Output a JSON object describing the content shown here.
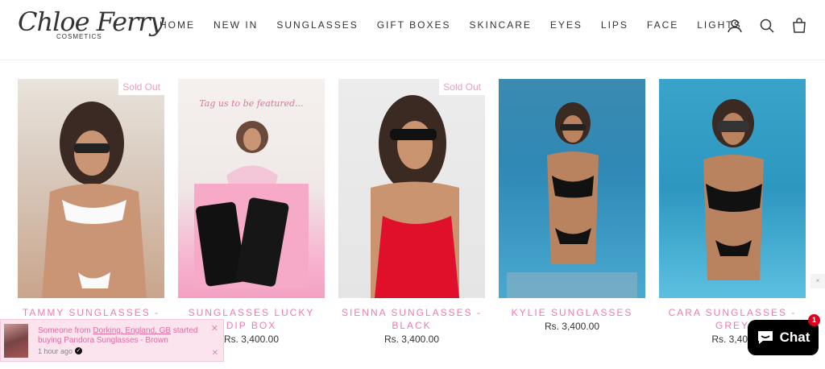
{
  "brand": {
    "name": "Chloe Ferry",
    "subtitle": "COSMETICS"
  },
  "nav": [
    "HOME",
    "NEW IN",
    "SUNGLASSES",
    "GIFT BOXES",
    "SKINCARE",
    "EYES",
    "LIPS",
    "FACE",
    "LIGHTS"
  ],
  "products": [
    {
      "name": "TAMMY SUNGLASSES -",
      "price": "",
      "badge": "Sold Out"
    },
    {
      "name": "SUNGLASSES LUCKY DIP BOX",
      "price": "Rs. 3,400.00",
      "badge": ""
    },
    {
      "name": "SIENNA SUNGLASSES - BLACK",
      "price": "Rs. 3,400.00",
      "badge": "Sold Out"
    },
    {
      "name": "KYLIE SUNGLASSES",
      "price": "Rs. 3,400.00",
      "badge": ""
    },
    {
      "name": "CARA SUNGLASSES - GREY",
      "price": "Rs. 3,400",
      "badge": ""
    }
  ],
  "popup": {
    "prefix": "Someone from ",
    "location": "Dorking, England, GB",
    "suffix": " started buying Pandora Sunglasses - Brown",
    "time": "1 hour ago"
  },
  "chat": {
    "label": "Chat",
    "badge": "1"
  }
}
